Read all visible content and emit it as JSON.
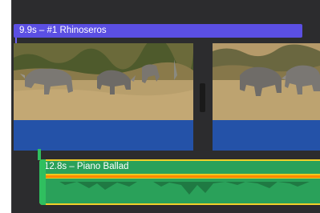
{
  "timeline": {
    "title_clip": {
      "label": "9.9s – #1 Rhinoseros",
      "color": "#5b4fe3"
    },
    "video_clips": [
      {
        "name": "rhinos-clip-1",
        "audio_color": "#2452a8"
      },
      {
        "name": "rhinos-clip-2",
        "audio_color": "#2452a8"
      }
    ],
    "audio_clip": {
      "label": "12.8s – Piano Ballad",
      "fill_color": "#2aa15a",
      "border_color": "#f2cf2a",
      "peak_color": "#ff8a00"
    }
  }
}
